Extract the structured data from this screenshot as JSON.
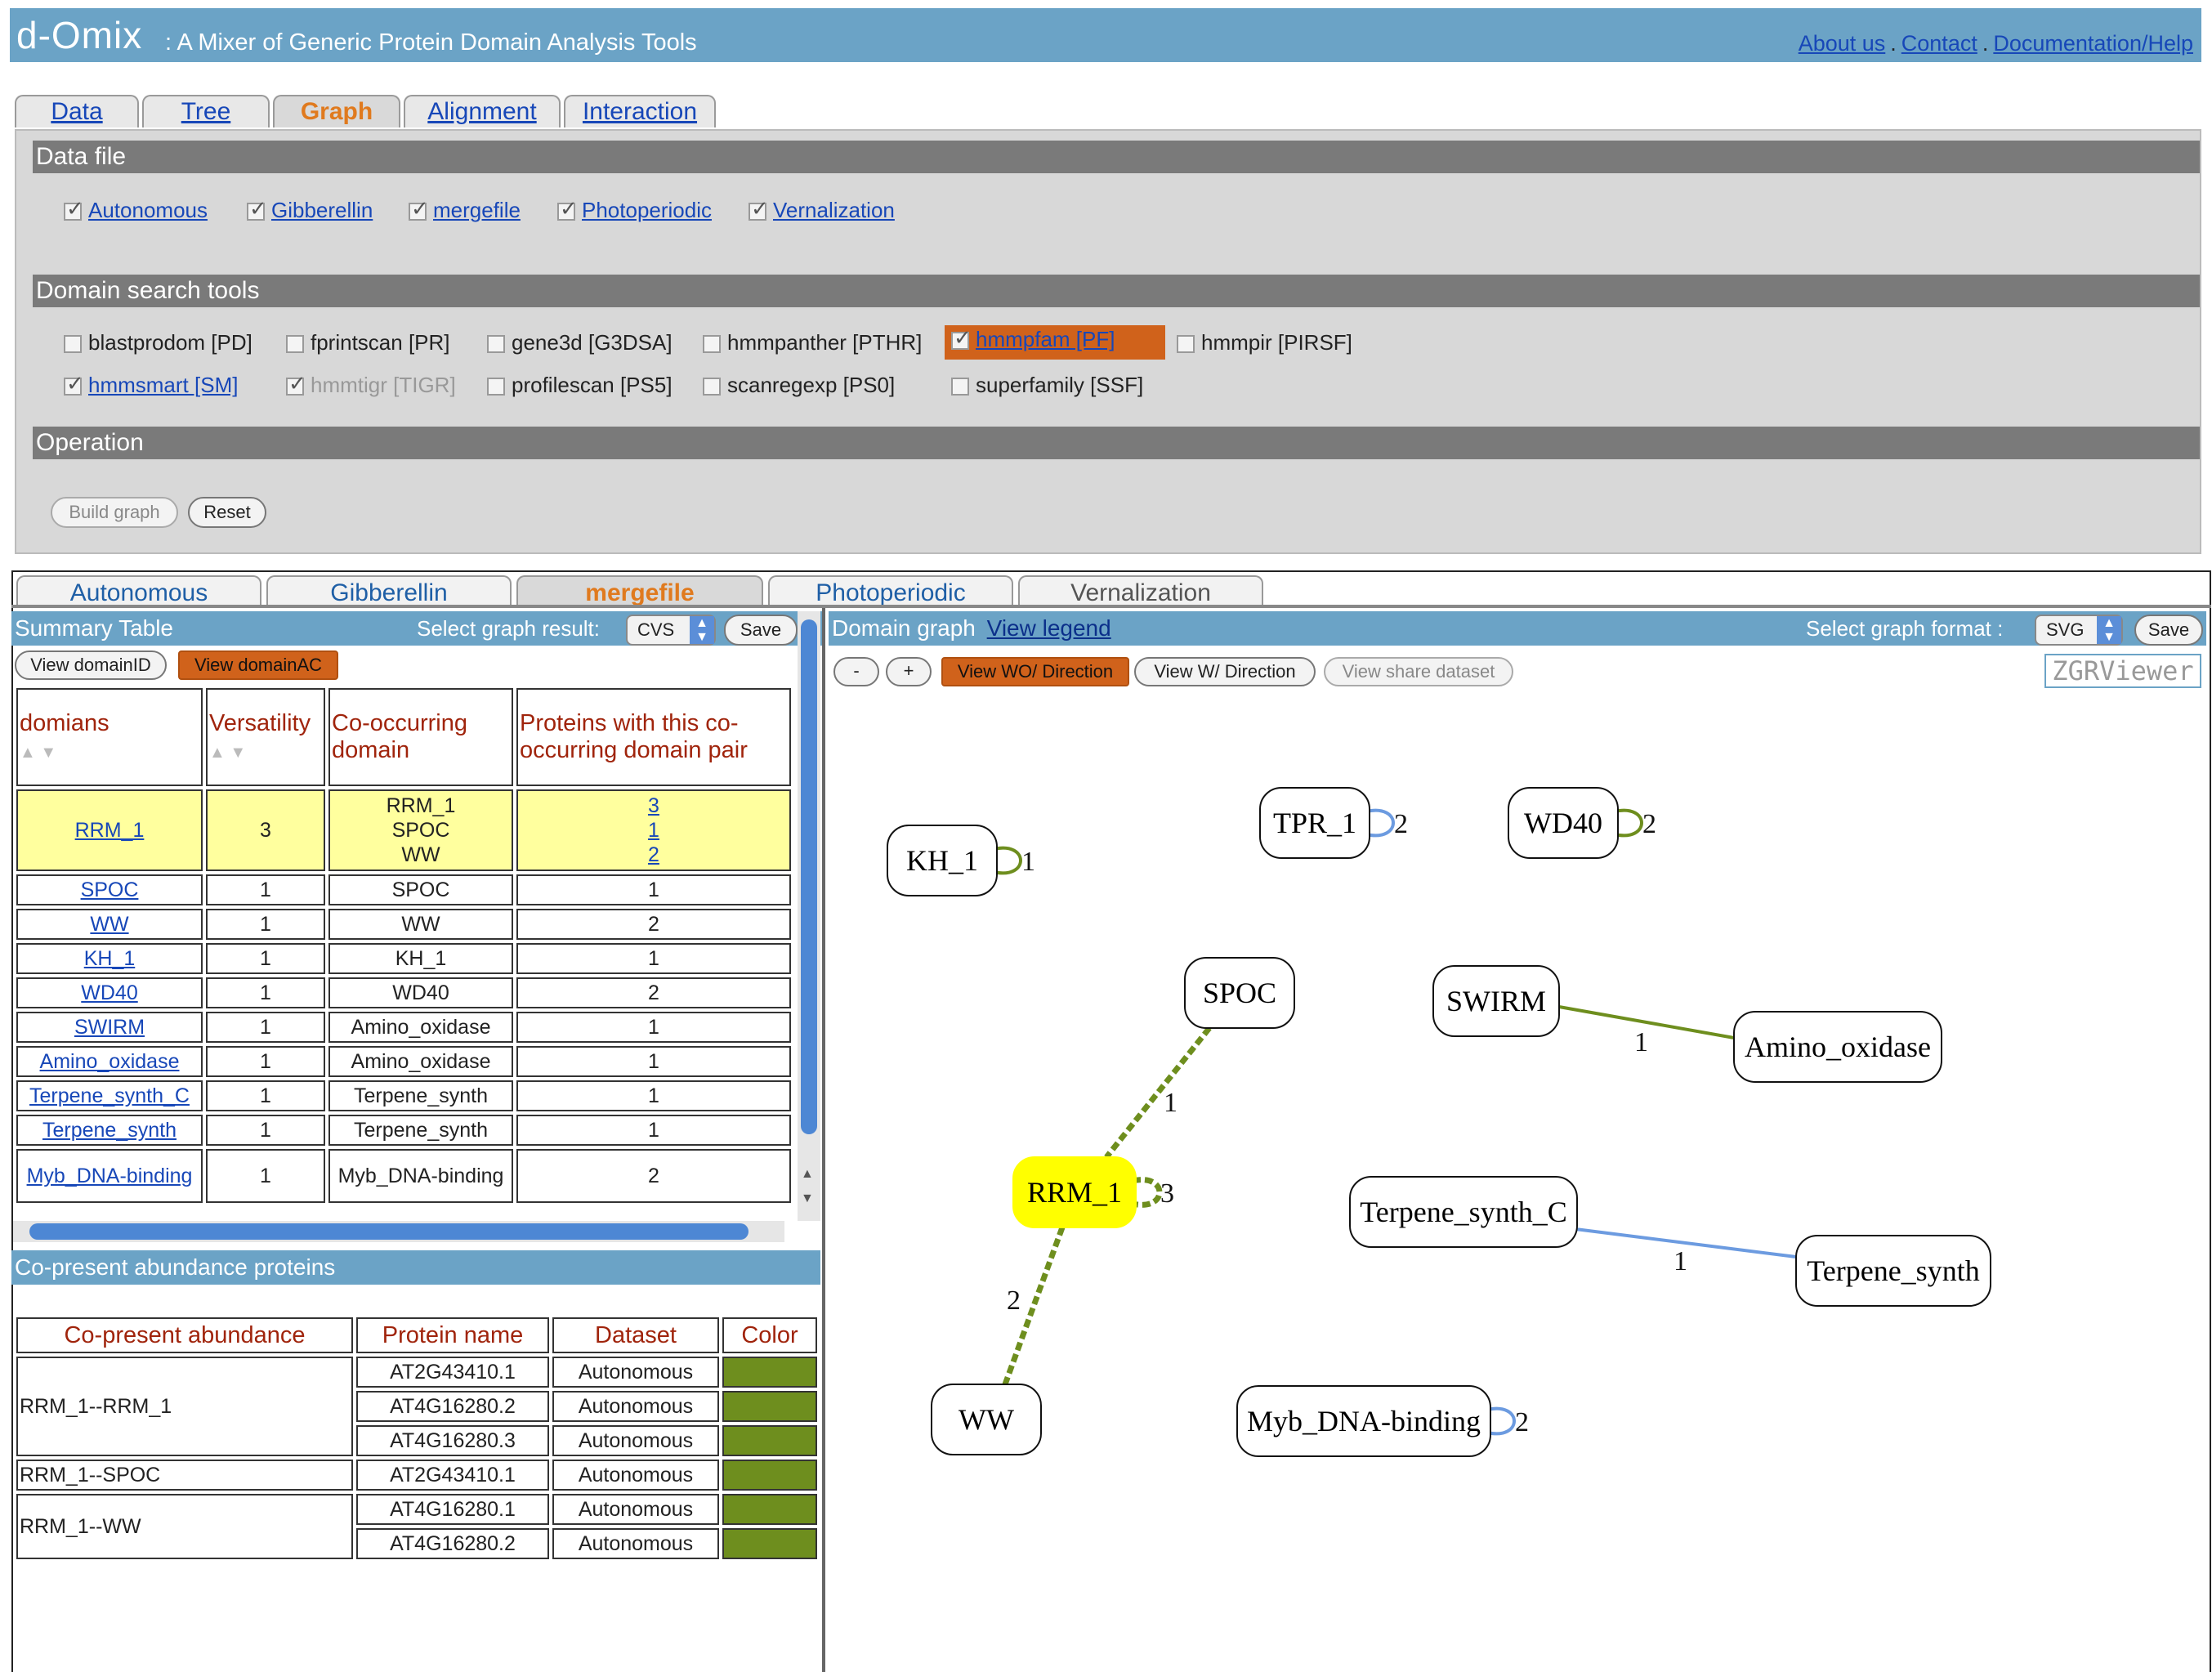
{
  "header": {
    "title": "d-Omix",
    "subtitle": ": A Mixer of Generic Protein Domain Analysis Tools",
    "links": [
      "About us",
      "Contact",
      "Documentation/Help"
    ],
    "sep": "."
  },
  "top_tabs": [
    "Data",
    "Tree",
    "Graph",
    "Alignment",
    "Interaction"
  ],
  "data_file": {
    "heading": "Data file",
    "files": [
      "Autonomous",
      "Gibberellin",
      "mergefile",
      "Photoperiodic",
      "Vernalization"
    ]
  },
  "tools": {
    "heading": "Domain search tools",
    "items": [
      "blastprodom [PD]",
      "fprintscan [PR]",
      "gene3d [G3DSA]",
      "hmmpanther [PTHR]",
      "hmmpfam [PF]",
      "hmmpir [PIRSF]",
      "hmmsmart [SM]",
      "hmmtigr [TIGR]",
      "profilescan [PS5]",
      "scanregexp [PS0]",
      "superfamily [SSF]"
    ]
  },
  "operation": {
    "heading": "Operation",
    "build": "Build graph",
    "reset": "Reset"
  },
  "dataset_tabs": [
    "Autonomous",
    "Gibberellin",
    "mergefile",
    "Photoperiodic",
    "Vernalization"
  ],
  "summary": {
    "title": "Summary Table",
    "select_label": "Select graph result:",
    "select_value": "CVS",
    "save": "Save",
    "view_id": "View domainID",
    "view_ac": "View domainAC",
    "headers": [
      "domians",
      "Versatility",
      "Co-occurring domain",
      "Proteins with this co-occurring domain pair"
    ],
    "first_row": {
      "domain": "RRM_1",
      "vers": "3",
      "co": [
        "RRM_1",
        "SPOC",
        "WW"
      ],
      "prot": [
        "3",
        "1",
        "2"
      ]
    },
    "rows": [
      [
        "SPOC",
        "1",
        "SPOC",
        "1"
      ],
      [
        "WW",
        "1",
        "WW",
        "2"
      ],
      [
        "KH_1",
        "1",
        "KH_1",
        "1"
      ],
      [
        "WD40",
        "1",
        "WD40",
        "2"
      ],
      [
        "SWIRM",
        "1",
        "Amino_oxidase",
        "1"
      ],
      [
        "Amino_oxidase",
        "1",
        "Amino_oxidase",
        "1"
      ],
      [
        "Terpene_synth_C",
        "1",
        "Terpene_synth",
        "1"
      ],
      [
        "Terpene_synth",
        "1",
        "Terpene_synth",
        "1"
      ],
      [
        "Myb_DNA-binding",
        "1",
        "Myb_DNA-binding",
        "2"
      ]
    ]
  },
  "copresent": {
    "title": "Co-present abundance proteins",
    "headers": [
      "Co-present abundance",
      "Protein name",
      "Dataset",
      "Color"
    ],
    "groups": [
      {
        "pair": "RRM_1--RRM_1",
        "rows": [
          [
            "AT2G43410.1",
            "Autonomous"
          ],
          [
            "AT4G16280.2",
            "Autonomous"
          ],
          [
            "AT4G16280.3",
            "Autonomous"
          ]
        ]
      },
      {
        "pair": "RRM_1--SPOC",
        "rows": [
          [
            "AT2G43410.1",
            "Autonomous"
          ]
        ]
      },
      {
        "pair": "RRM_1--WW",
        "rows": [
          [
            "AT4G16280.1",
            "Autonomous"
          ],
          [
            "AT4G16280.2",
            "Autonomous"
          ]
        ]
      }
    ],
    "color": "#6e8e1e"
  },
  "graph": {
    "title": "Domain graph",
    "legend": "View legend",
    "format_label": "Select graph format :",
    "format_value": "SVG",
    "save": "Save",
    "minus": "-",
    "plus": "+",
    "wo_dir": "View WO/ Direction",
    "w_dir": "View W/ Direction",
    "share": "View share dataset",
    "viewer": "ZGRViewer",
    "nodes": [
      "KH_1",
      "TPR_1",
      "WD40",
      "SPOC",
      "SWIRM",
      "Amino_oxidase",
      "RRM_1",
      "Terpene_synth_C",
      "Terpene_synth",
      "WW",
      "Myb_DNA-binding"
    ],
    "edge_labels": [
      "1",
      "2",
      "2",
      "1",
      "1",
      "3",
      "2",
      "1",
      "2"
    ],
    "colors": {
      "green": "#6e8e1e",
      "blue": "#6c9be0",
      "highlight": "#ffff00"
    }
  }
}
